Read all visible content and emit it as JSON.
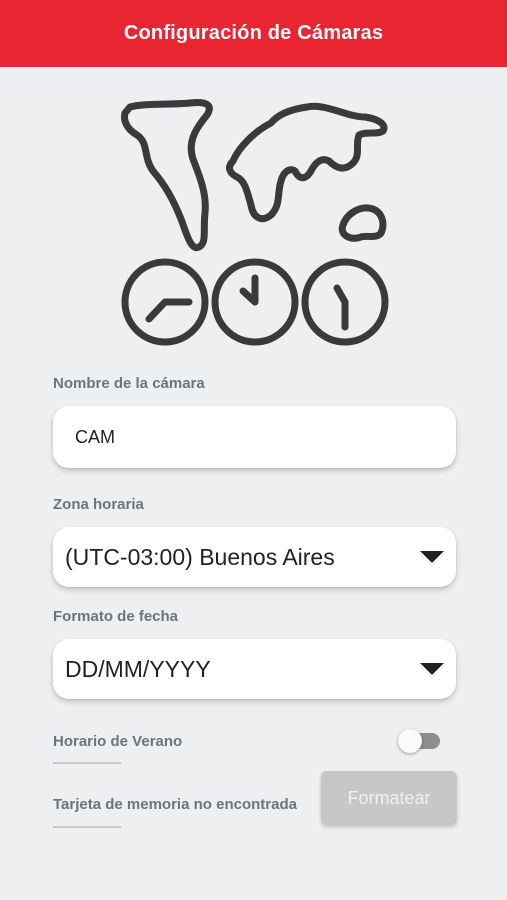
{
  "appbar": {
    "title": "Configuración de Cámaras"
  },
  "hero": {
    "icon": "world-map-three-clocks-icon"
  },
  "camera_name": {
    "label": "Nombre de la cámara",
    "value": "CAM"
  },
  "timezone": {
    "label": "Zona horaria",
    "selected": "(UTC-03:00) Buenos Aires"
  },
  "date_format": {
    "label": "Formato de fecha",
    "selected": "DD/MM/YYYY"
  },
  "dst": {
    "label": "Horario de Verano",
    "enabled": false
  },
  "memory_card": {
    "status": "Tarjeta de memoria no encontrada",
    "button_label": "Formatear"
  },
  "colors": {
    "accent": "#e82531",
    "background": "#eeeff1",
    "label": "#6d747c",
    "icon_stroke": "#3a3a3a"
  }
}
